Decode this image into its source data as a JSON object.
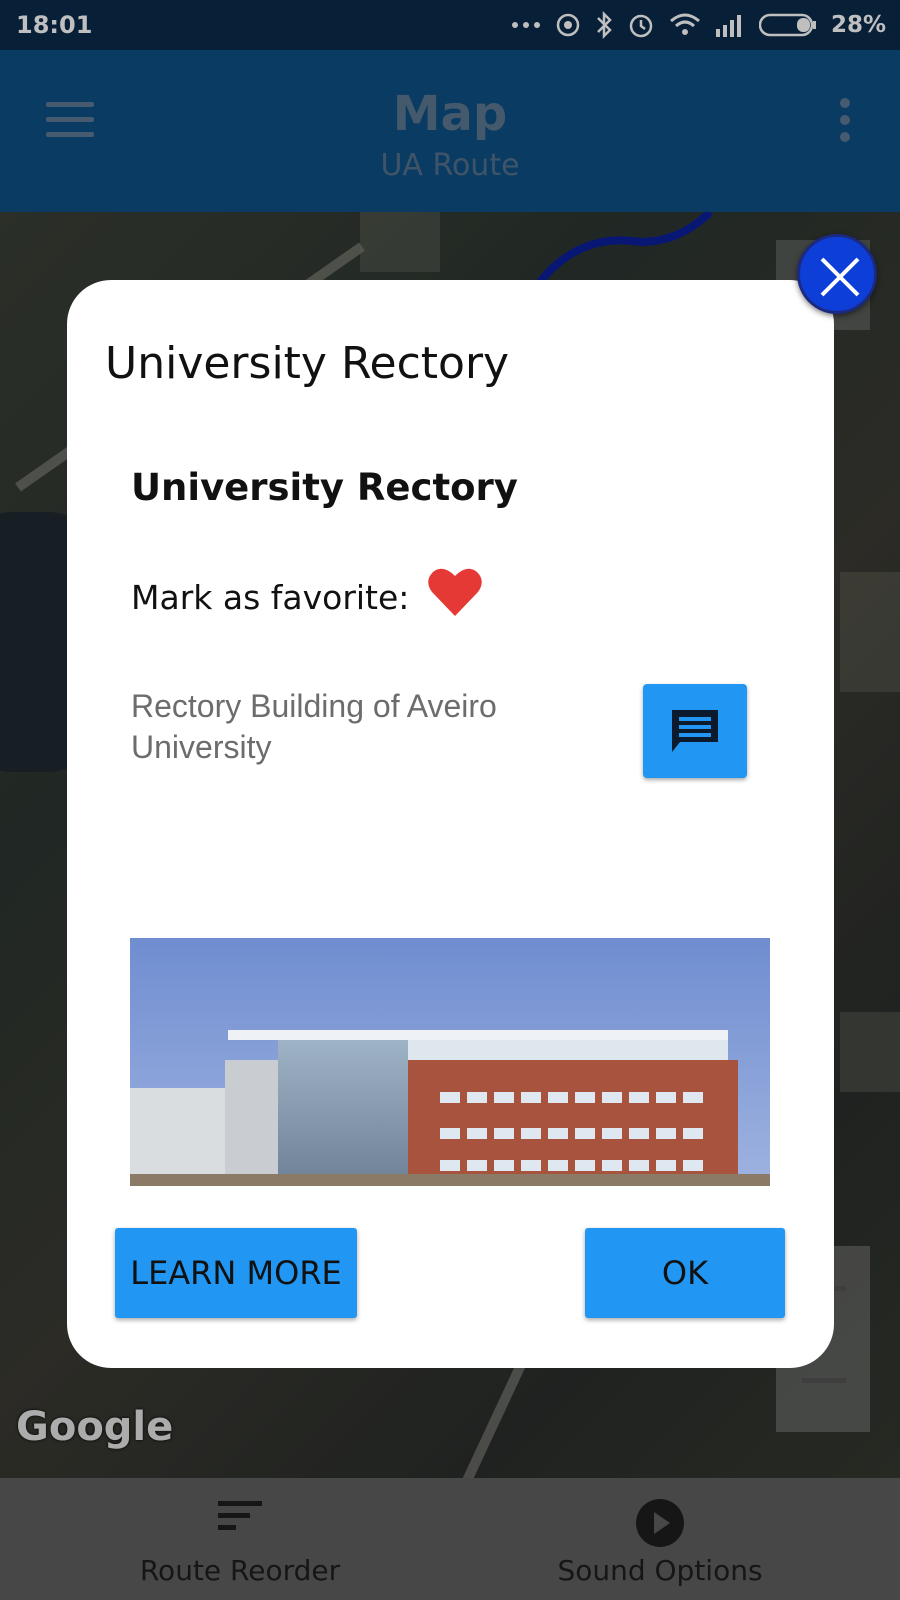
{
  "status_bar": {
    "time": "18:01",
    "battery_percent": "28%",
    "icons": [
      "more-dots-icon",
      "hotspot-icon",
      "bluetooth-icon",
      "alarm-icon",
      "wifi-icon",
      "signal-icon",
      "battery-icon"
    ]
  },
  "app_bar": {
    "title": "Map",
    "subtitle": "UA Route",
    "menu_icon": "hamburger-menu-icon",
    "overflow_icon": "more-vert-icon",
    "color": "#0e4f83"
  },
  "map": {
    "attribution": "Google"
  },
  "dialog": {
    "title": "University Rectory",
    "place_name": "University Rectory",
    "favorite_label": "Mark as favorite:",
    "favorite_icon": "heart-icon",
    "favorite_color": "#e53935",
    "description": "Rectory Building of Aveiro University",
    "comment_icon": "comment-icon",
    "learn_more_label": "LEARN MORE",
    "ok_label": "OK",
    "close_icon": "close-icon",
    "accent": "#2196f3"
  },
  "bottom_nav": {
    "items": [
      {
        "label": "Route Reorder",
        "icon": "sort-icon"
      },
      {
        "label": "Sound Options",
        "icon": "play-circle-icon"
      }
    ]
  }
}
